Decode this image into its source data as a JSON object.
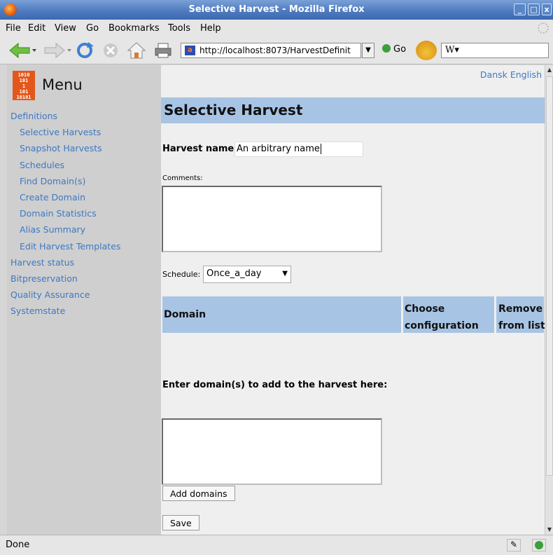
{
  "window": {
    "title": "Selective Harvest - Mozilla Firefox"
  },
  "menubar": [
    "File",
    "Edit",
    "View",
    "Go",
    "Bookmarks",
    "Tools",
    "Help"
  ],
  "toolbar": {
    "url": "http://localhost:8073/HarvestDefinit",
    "go_label": "Go",
    "search_value": "W"
  },
  "sidebar": {
    "menu_title": "Menu",
    "logo_text": "1010\n101\n1\n101\n10101",
    "items": [
      {
        "label": "Definitions",
        "level": "top"
      },
      {
        "label": "Selective Harvests",
        "level": "sub"
      },
      {
        "label": "Snapshot Harvests",
        "level": "sub"
      },
      {
        "label": "Schedules",
        "level": "sub"
      },
      {
        "label": "Find Domain(s)",
        "level": "sub"
      },
      {
        "label": "Create Domain",
        "level": "sub"
      },
      {
        "label": "Domain Statistics",
        "level": "sub"
      },
      {
        "label": "Alias Summary",
        "level": "sub"
      },
      {
        "label": "Edit Harvest Templates",
        "level": "sub"
      },
      {
        "label": "Harvest status",
        "level": "top"
      },
      {
        "label": "Bitpreservation",
        "level": "top"
      },
      {
        "label": "Quality Assurance",
        "level": "top"
      },
      {
        "label": "Systemstate",
        "level": "top"
      }
    ]
  },
  "main": {
    "lang_dansk": "Dansk",
    "lang_english": "English",
    "heading": "Selective Harvest",
    "harvest_name_label": "Harvest name:",
    "harvest_name_value": "An arbitrary name",
    "comments_label": "Comments:",
    "schedule_label": "Schedule:",
    "schedule_value": "Once_a_day",
    "table": {
      "col_domain": "Domain",
      "col_choose": "Choose configuration",
      "col_remove": "Remove from list"
    },
    "enter_domains_label": "Enter domain(s) to add to the harvest here:",
    "add_domains_button": "Add domains",
    "save_button": "Save"
  },
  "status": {
    "text": "Done"
  },
  "colors": {
    "link": "#3d78c3",
    "heading_bg": "#a8c4e4",
    "sidebar_bg": "#cfcfcf",
    "content_bg": "#efefef",
    "titlebar": "#4f7cc0"
  }
}
